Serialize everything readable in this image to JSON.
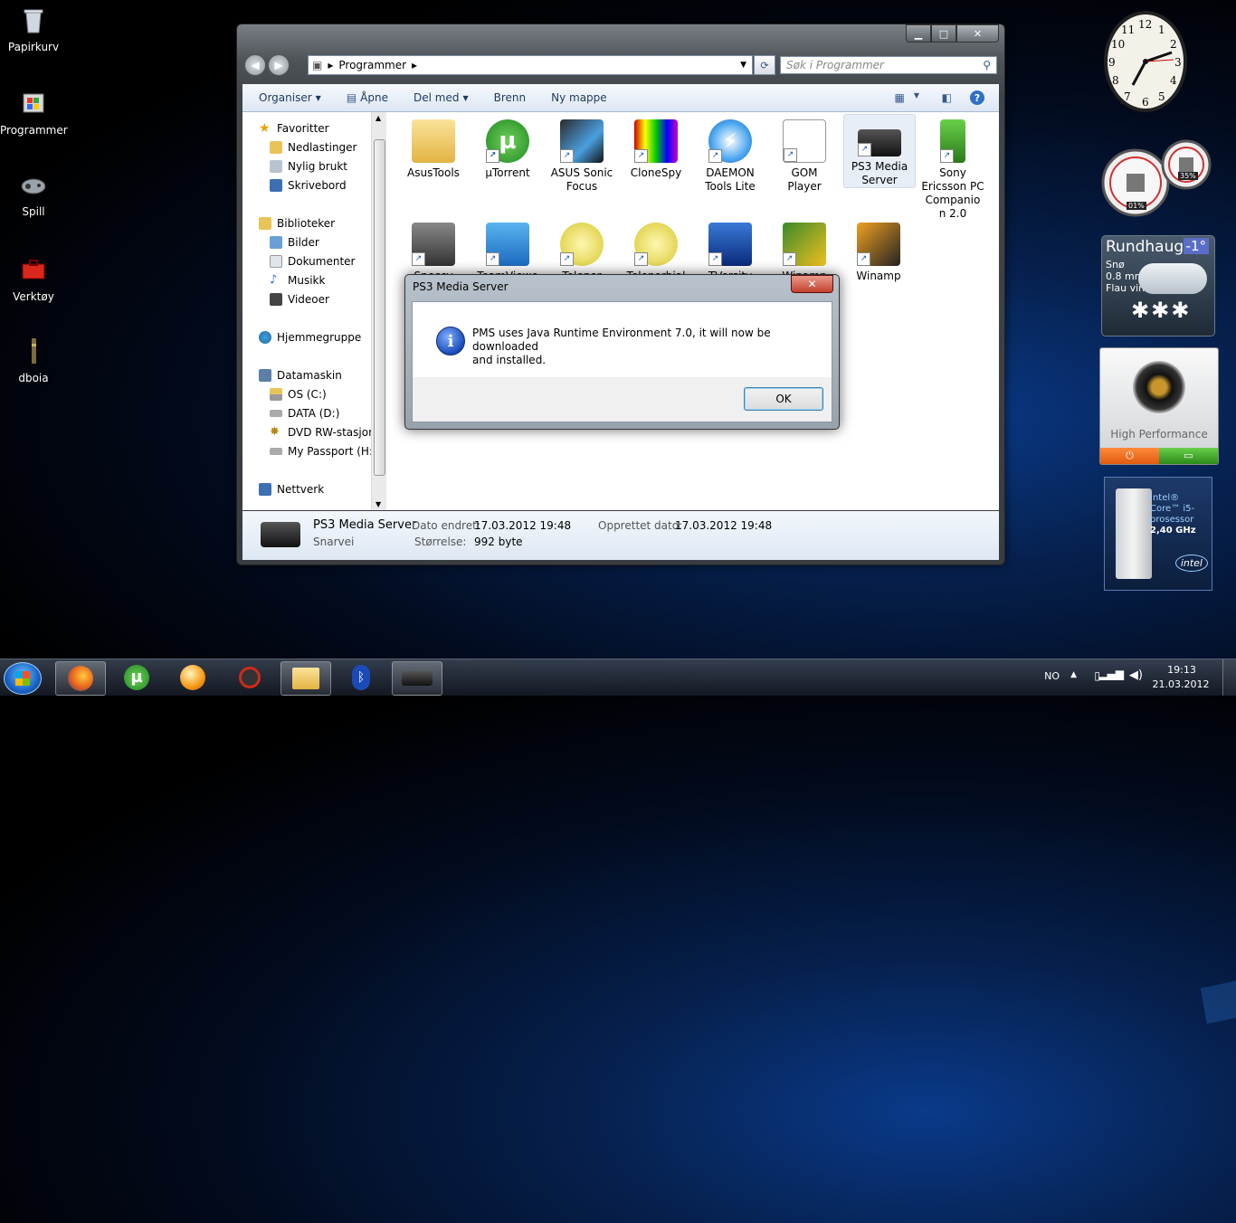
{
  "desktop": {
    "icons": [
      {
        "label": "Papirkurv"
      },
      {
        "label": "Programmer"
      },
      {
        "label": "Spill"
      },
      {
        "label": "Verktøy"
      },
      {
        "label": "dboia"
      }
    ]
  },
  "explorer": {
    "breadcrumb": "Programmer",
    "search_placeholder": "Søk i Programmer",
    "toolbar": {
      "organise": "Organiser",
      "open": "Åpne",
      "share": "Del med",
      "burn": "Brenn",
      "new_folder": "Ny mappe"
    },
    "nav": {
      "favorites": "Favoritter",
      "downloads": "Nedlastinger",
      "recent": "Nylig brukt",
      "desktop": "Skrivebord",
      "libraries": "Biblioteker",
      "pictures": "Bilder",
      "documents": "Dokumenter",
      "music": "Musikk",
      "videos": "Videoer",
      "homegroup": "Hjemmegruppe",
      "computer": "Datamaskin",
      "os": "OS (C:)",
      "data": "DATA (D:)",
      "dvd": "DVD RW-stasjon",
      "passport": "My Passport (H:)",
      "network": "Nettverk"
    },
    "files_row1": [
      {
        "l1": "AsusTools",
        "l2": ""
      },
      {
        "l1": "µTorrent",
        "l2": ""
      },
      {
        "l1": "ASUS Sonic",
        "l2": "Focus"
      },
      {
        "l1": "CloneSpy",
        "l2": ""
      },
      {
        "l1": "DAEMON",
        "l2": "Tools Lite"
      },
      {
        "l1": "GOM",
        "l2": "Player"
      },
      {
        "l1": "PS3 Media",
        "l2": "Server"
      },
      {
        "l1": "Sony",
        "l2": "Ericsson PC",
        "l3": "Companio",
        "l4": "n 2.0"
      }
    ],
    "files_row2": [
      {
        "l1": "Speccy"
      },
      {
        "l1": "TeamViewe"
      },
      {
        "l1": "Telenor"
      },
      {
        "l1": "Telenorbial"
      },
      {
        "l1": "TVersity"
      },
      {
        "l1": "Winamp"
      },
      {
        "l1": "Winamp"
      }
    ],
    "details": {
      "name": "PS3 Media Server",
      "type": "Snarvei",
      "modified_label": "Dato endret:",
      "modified_value": "17.03.2012 19:48",
      "size_label": "Størrelse:",
      "size_value": "992 byte",
      "created_label": "Opprettet dato:",
      "created_value": "17.03.2012 19:48"
    }
  },
  "dialog": {
    "title": "PS3 Media Server",
    "message_line1": "PMS uses Java Runtime Environment 7.0, it will now be downloaded",
    "message_line2": "and installed.",
    "ok": "OK"
  },
  "gadgets": {
    "clock_numbers": [
      "12",
      "1",
      "2",
      "3",
      "4",
      "5",
      "6",
      "7",
      "8",
      "9",
      "10",
      "11"
    ],
    "cpu_meter": "01%",
    "mem_meter": "35%",
    "weather_city": "Rundhaug",
    "weather_temp": "-1°",
    "weather_cond": "Snø",
    "weather_precip": "0.8 mm",
    "weather_wind": "Flau vind",
    "power_plan": "High Performance",
    "intel_l1": "Intel®",
    "intel_l2": "Core™ i5-",
    "intel_l3": "prosessor",
    "intel_l4": "2,40 GHz",
    "intel_logo": "intel"
  },
  "taskbar": {
    "lang": "NO",
    "time": "19:13",
    "date": "21.03.2012"
  }
}
